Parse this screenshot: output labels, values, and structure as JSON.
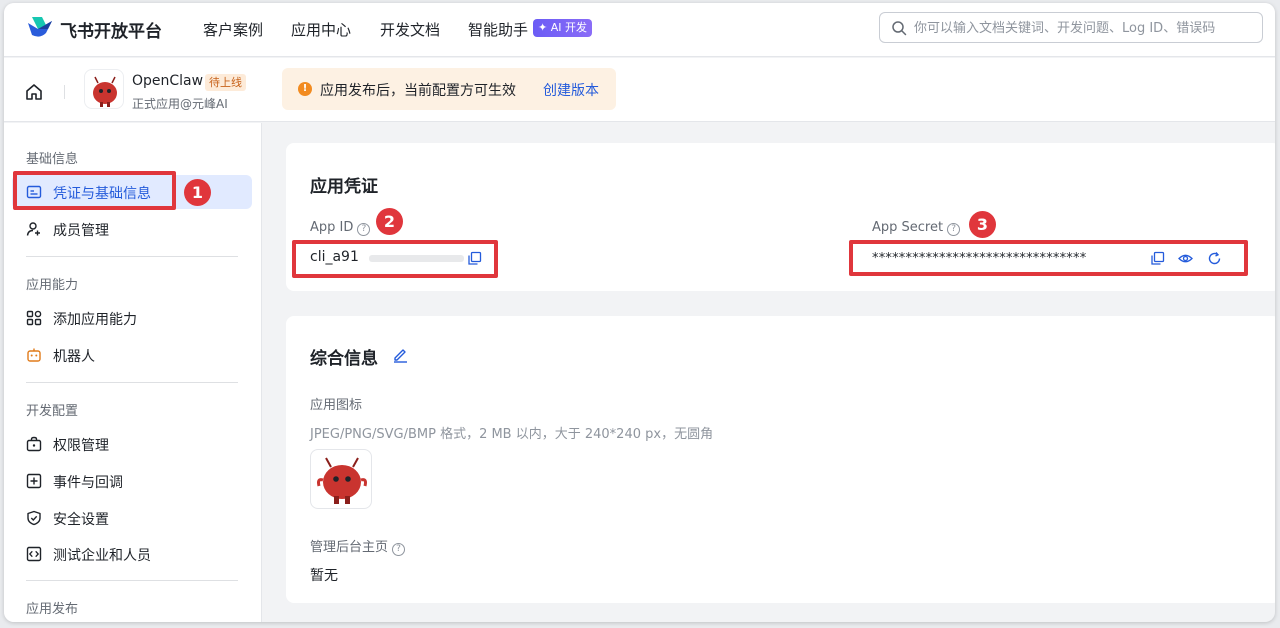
{
  "topnav": {
    "brand": "飞书开放平台",
    "links": [
      "客户案例",
      "应用中心",
      "开发文档",
      "智能助手"
    ],
    "ai_badge": "✦ AI 开发",
    "search_placeholder": "你可以输入文档关键词、开发问题、Log ID、错误码"
  },
  "app": {
    "name": "OpenClaw",
    "status": "待上线",
    "subtitle": "正式应用@元峰AI"
  },
  "notice": {
    "text": "应用发布后，当前配置方可生效",
    "link": "创建版本"
  },
  "sidebar": {
    "sections": [
      {
        "title": "基础信息",
        "items": [
          {
            "label": "凭证与基础信息",
            "icon": "id-card-icon",
            "active": true
          },
          {
            "label": "成员管理",
            "icon": "user-add-icon"
          }
        ]
      },
      {
        "title": "应用能力",
        "items": [
          {
            "label": "添加应用能力",
            "icon": "grid-icon"
          },
          {
            "label": "机器人",
            "icon": "robot-icon"
          }
        ]
      },
      {
        "title": "开发配置",
        "items": [
          {
            "label": "权限管理",
            "icon": "lock-box-icon"
          },
          {
            "label": "事件与回调",
            "icon": "event-icon"
          },
          {
            "label": "安全设置",
            "icon": "shield-icon"
          },
          {
            "label": "测试企业和人员",
            "icon": "code-icon"
          }
        ]
      },
      {
        "title": "应用发布",
        "items": []
      }
    ]
  },
  "credentials": {
    "title": "应用凭证",
    "app_id_label": "App ID",
    "app_id_value": "cli_a91",
    "app_secret_label": "App Secret",
    "app_secret_value": "********************************"
  },
  "general": {
    "title": "综合信息",
    "icon_label": "应用图标",
    "icon_hint": "JPEG/PNG/SVG/BMP 格式，2 MB 以内，大于 240*240 px，无圆角",
    "homepage_label": "管理后台主页",
    "homepage_value": "暂无"
  },
  "annotations": [
    "1",
    "2",
    "3"
  ],
  "colors": {
    "accent": "#245bdb",
    "annotation": "#e0363c",
    "warning": "#f28b20"
  }
}
